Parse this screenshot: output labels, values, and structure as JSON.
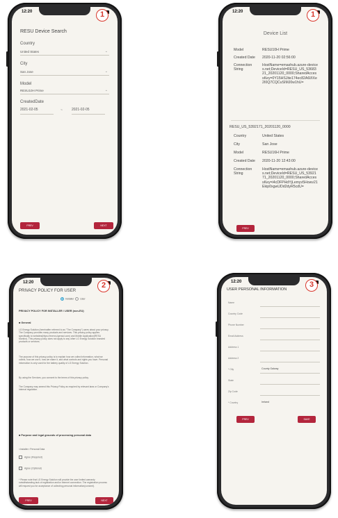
{
  "status": {
    "time": "12:20"
  },
  "badges": {
    "p1": "1",
    "p2": "1",
    "p3": "2",
    "p4": "3"
  },
  "search": {
    "title": "RESU Device Search",
    "country_label": "Country",
    "country_value": "United States",
    "city_label": "City",
    "city_value": "San Jose",
    "model_label": "Model",
    "model_value": "RESU10H Prime",
    "created_label": "CreatedDate",
    "date_from": "2021-02-05",
    "date_sep": "~",
    "date_to": "2021-02-05",
    "prev": "PREV",
    "next": "NEXT"
  },
  "device_list": {
    "title": "Device List",
    "device1": {
      "model_label": "Model",
      "model": "RESU10H Prime",
      "created_label": "Created Date",
      "created": "2020-11-20 02:56:00",
      "conn_label": "Connection String",
      "conn": "HostName=emashub.azure-devices.net;DeviceId=RESU_US_5368321_20201120_0000;SharedAccessKey=0Y15HSJite174ec82A6I/IXe2I0Q7CQCuSIMJ0w1hU="
    },
    "device2": {
      "title": "RESU_US_5392171_20201120_0000",
      "country_label": "Country",
      "country": "United States",
      "city_label": "City",
      "city": "San Jose",
      "model_label": "Model",
      "model": "RESU16H Prime",
      "created_label": "Created Date",
      "created": "2020-11-20 12:43:00",
      "conn_label": "Connection String",
      "conn": "HostName=emashub.azure-devices.net;DeviceId=RESU_US_5392171_20201120_0000;SharedAccessKey=i4cDFPHdYjLemyv5Howv21Ekip0xgwUDd2dyR5cdU="
    },
    "prev": "PREV"
  },
  "privacy": {
    "title": "PRIVACY POLICY FOR USER",
    "radio_installer": "Installer",
    "radio_user": "User",
    "heading1": "PRIVACY POLICY FOR INSTALLER / USER (non-EU)",
    "general": "■ General",
    "para1": "LG Energy Solution (hereinafter referred to as \"The Company\") cares about your privacy. The Company provides many products and services. This privacy policy applies specifically to websites(https://enervu.lgensol.com) and Mobile Application(RESU Monitor). This privacy policy does not apply to any other LG Energy Solution branded products or services.",
    "para2": "The purpose of this privacy policy is to explain how we collect information, what we collect, how we use it, how we share it, and what controls and rights you have. Personal information is only used for the battery quality of LG Energy Solution.",
    "para3": "By using the Services, you consent to the terms of this privacy policy.",
    "para4": "The Company may amend this Privacy Policy as required by relevant laws or Company's internal regulation.",
    "heading2": "■ Purpose and legal grounds of processing personal data",
    "sub": "<Installer> Personal Data",
    "chk1": "Agree (Required)",
    "chk2": "Agree (Optional)",
    "note": "* Please note that LG Energy Solution will provide the user limited warranty notwithstanding lack of registration and/or Internet connection. The registration process will request you for acceptance of collecting personal information(consent).",
    "prev": "PREV",
    "next": "NEXT"
  },
  "user_info": {
    "title": "USER PERSONAL INFORMATION",
    "fields": [
      "Name",
      "Country Code",
      "Phone Number",
      "Email Address",
      "Address 1",
      "Address 2",
      "* City",
      "State",
      "Zip Code",
      "* Country"
    ],
    "city_value": "County Galway",
    "country_value": "Ireland",
    "prev": "PREV",
    "save": "SAVE"
  }
}
